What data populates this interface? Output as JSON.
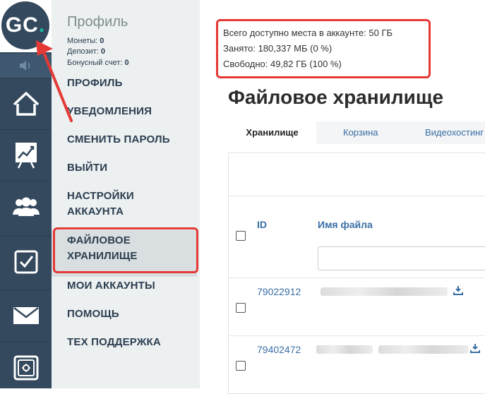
{
  "logo": {
    "letters": "GC",
    "dot": "."
  },
  "profile": {
    "title": "Профиль",
    "coins_label": "Монеты:",
    "coins_value": "0",
    "deposit_label": "Депозит:",
    "deposit_value": "0",
    "bonus_label": "Бонусный счет:",
    "bonus_value": "0"
  },
  "rail": {
    "icons": [
      "speaker-icon",
      "home-icon",
      "chart-icon",
      "users-icon",
      "checkbox-icon",
      "mail-icon",
      "safe-icon"
    ]
  },
  "menu": {
    "items": [
      "ПРОФИЛЬ",
      "УВЕДОМЛЕНИЯ",
      "СМЕНИТЬ ПАРОЛЬ",
      "ВЫЙТИ",
      "НАСТРОЙКИ АККАУНТА",
      "ФАЙЛОВОЕ ХРАНИЛИЩЕ",
      "МОИ АККАУНТЫ",
      "ПОМОЩЬ",
      "ТЕХ ПОДДЕРЖКА"
    ],
    "active": "ФАЙЛОВОЕ ХРАНИЛИЩЕ"
  },
  "storage": {
    "total": "Всего доступно места в аккаунте: 50 ГБ",
    "used": "Занято: 180,337 МБ (0 %)",
    "free": "Свободно: 49,82 ГБ (100 %)"
  },
  "page_title": "Файловое хранилище",
  "tabs": [
    "Хранилище",
    "Корзина",
    "Видеохостинг"
  ],
  "table": {
    "col_id": "ID",
    "col_name": "Имя файла",
    "rows": [
      {
        "id": "79022912"
      },
      {
        "id": "79402472"
      }
    ]
  },
  "colors": {
    "rail": "#34495e",
    "menu_bg": "#ecf0f1",
    "link": "#3a6ea5",
    "annotation": "#e53935",
    "logo_dot": "#1abc9c"
  }
}
